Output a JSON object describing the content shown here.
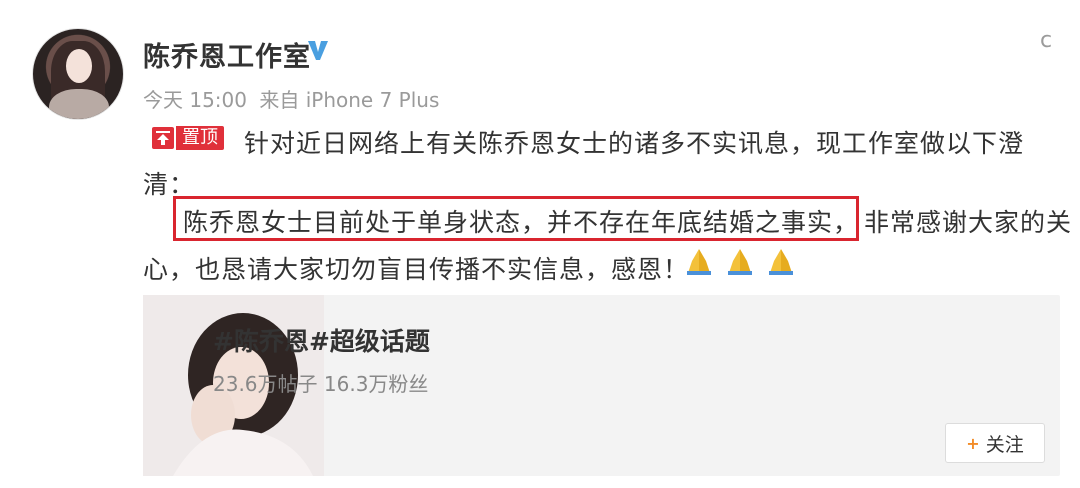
{
  "post": {
    "author_name": "陈乔恩工作室",
    "verified": true,
    "meta_time": "今天 15:00",
    "meta_from": "来自 iPhone 7 Plus",
    "pin_label": "置顶",
    "text_line1": "针对近日网络上有关陈乔恩女士的诸多不实讯息，现工作室做以下澄",
    "text_line2": "清：",
    "text_highlight": "陈乔恩女士目前处于单身状态，并不存在年底结婚之事实，",
    "text_line3_rest": "非常感谢大家的关",
    "text_line4": "心，也恳请大家切勿盲目传播不实信息，感恩！",
    "corner_mark": "c"
  },
  "card": {
    "title": "#陈乔恩#超级话题",
    "stats": "23.6万帖子 16.3万粉丝",
    "follow_label": "关注"
  },
  "colors": {
    "accent_red": "#e0303a",
    "verified_blue": "#4a9fe0",
    "follow_plus": "#f28c28"
  },
  "icons": [
    "avatar",
    "verified-v-icon",
    "pin-icon",
    "praying-hands-emoji",
    "plus-icon"
  ]
}
